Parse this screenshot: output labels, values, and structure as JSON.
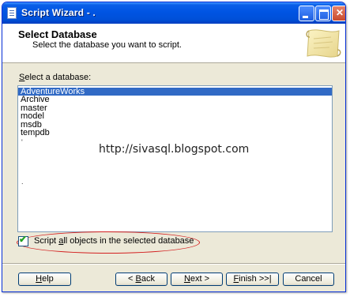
{
  "window": {
    "title": "Script Wizard - ."
  },
  "header": {
    "title": "Select Database",
    "subtitle": "Select the database you want to script."
  },
  "database_list": {
    "label_mnemonic": "S",
    "label_rest": "elect a database:",
    "items": [
      "AdventureWorks",
      "Archive",
      "master",
      "model",
      "msdb",
      "tempdb"
    ],
    "selected_index": 0,
    "stray_marks": [
      "'",
      "."
    ]
  },
  "watermark": "http://sivasql.blogspot.com",
  "script_all_checkbox": {
    "checked": true,
    "label_pre": "Script ",
    "label_mnemonic": "a",
    "label_post": "ll objects in the selected database"
  },
  "buttons": {
    "help": {
      "mnemonic": "H",
      "rest": "elp"
    },
    "back": {
      "pre": "< ",
      "mnemonic": "B",
      "rest": "ack"
    },
    "next": {
      "mnemonic": "N",
      "rest": "ext >"
    },
    "finish": {
      "mnemonic": "F",
      "rest": "inish >>|"
    },
    "cancel": {
      "label": "Cancel"
    }
  },
  "colors": {
    "titlebar": "#0054e3",
    "selection": "#316ac5",
    "annotation_ellipse": "#d32020"
  }
}
